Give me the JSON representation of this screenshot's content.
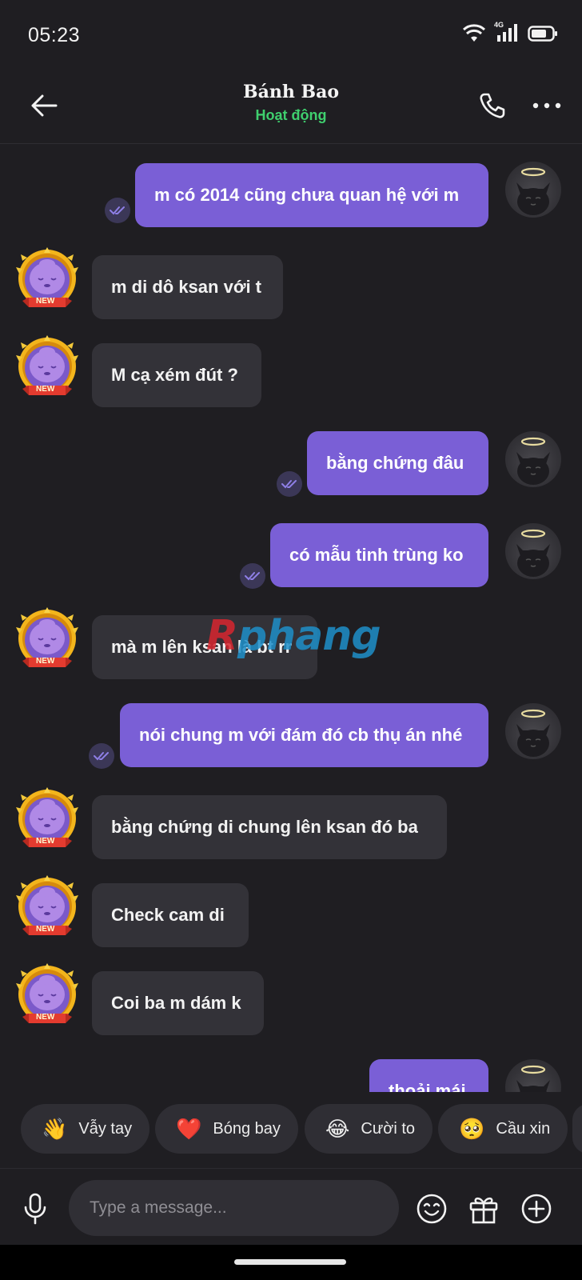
{
  "status_bar": {
    "time": "05:23",
    "network": "4G"
  },
  "header": {
    "title": "Bánh Bao",
    "status": "Hoạt động"
  },
  "messages": [
    {
      "dir": "out",
      "text": "m có 2014 cũng chưa quan hệ với m"
    },
    {
      "dir": "in",
      "text": "m di dô ksan với t",
      "badge": "NEW"
    },
    {
      "dir": "in",
      "text": "M cạ xém đút ?",
      "badge": "NEW"
    },
    {
      "dir": "out",
      "text": "bằng chứng đâu"
    },
    {
      "dir": "out",
      "text": "có mẫu tinh trùng ko"
    },
    {
      "dir": "in",
      "text": "mà m lên ksan là bt rr",
      "badge": "NEW"
    },
    {
      "dir": "out",
      "text": "nói chung m với đám đó cb thụ án nhé"
    },
    {
      "dir": "in",
      "text": "bằng chứng di chung lên ksan đó ba",
      "badge": "NEW"
    },
    {
      "dir": "in",
      "text": "Check cam di",
      "badge": "NEW"
    },
    {
      "dir": "in",
      "text": "Coi ba m dám k",
      "badge": "NEW"
    },
    {
      "dir": "out",
      "text": "thoải mái"
    }
  ],
  "watermark": {
    "r": "R",
    "rest": "phang"
  },
  "reactions": [
    {
      "emoji": "👋",
      "label": "Vẫy tay"
    },
    {
      "emoji": "❤️",
      "label": "Bóng bay"
    },
    {
      "emoji": "😂",
      "label": "Cười to"
    },
    {
      "emoji": "🥺",
      "label": "Cầu xin"
    }
  ],
  "composer": {
    "placeholder": "Type a message..."
  },
  "colors": {
    "bubble_out": "#7a5fd6",
    "bubble_in": "#333238",
    "status_online": "#3fcf6e",
    "background": "#1f1e22"
  }
}
